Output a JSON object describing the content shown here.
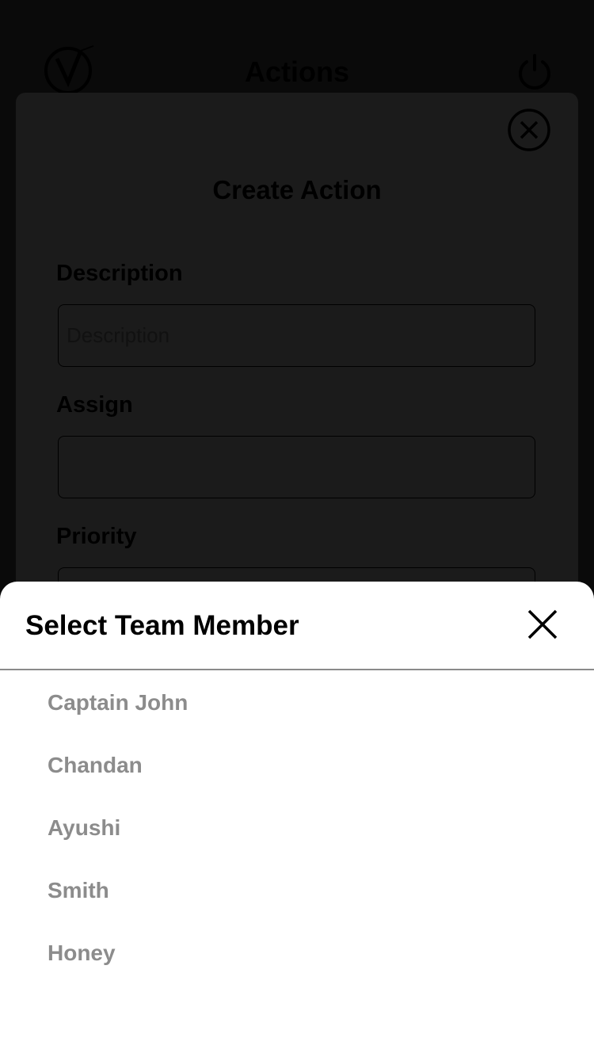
{
  "header": {
    "title": "Actions",
    "logo_icon": "v-logo-icon",
    "power_icon": "power-icon"
  },
  "create_action": {
    "title": "Create Action",
    "close_icon": "close-circle-icon",
    "fields": {
      "description": {
        "label": "Description",
        "placeholder": "Description",
        "value": ""
      },
      "assign": {
        "label": "Assign",
        "value": ""
      },
      "priority": {
        "label": "Priority",
        "value": ""
      }
    }
  },
  "sheet": {
    "title": "Select Team Member",
    "close_icon": "close-icon",
    "members": [
      "Captain John",
      "Chandan",
      "Ayushi",
      "Smith",
      "Honey"
    ]
  },
  "colors": {
    "overlay_bg": "#0a0a0a",
    "card_bg": "#1b1b1b",
    "sheet_bg": "#ffffff",
    "member_text": "#8c8c8c",
    "divider": "#8a8a8a"
  }
}
